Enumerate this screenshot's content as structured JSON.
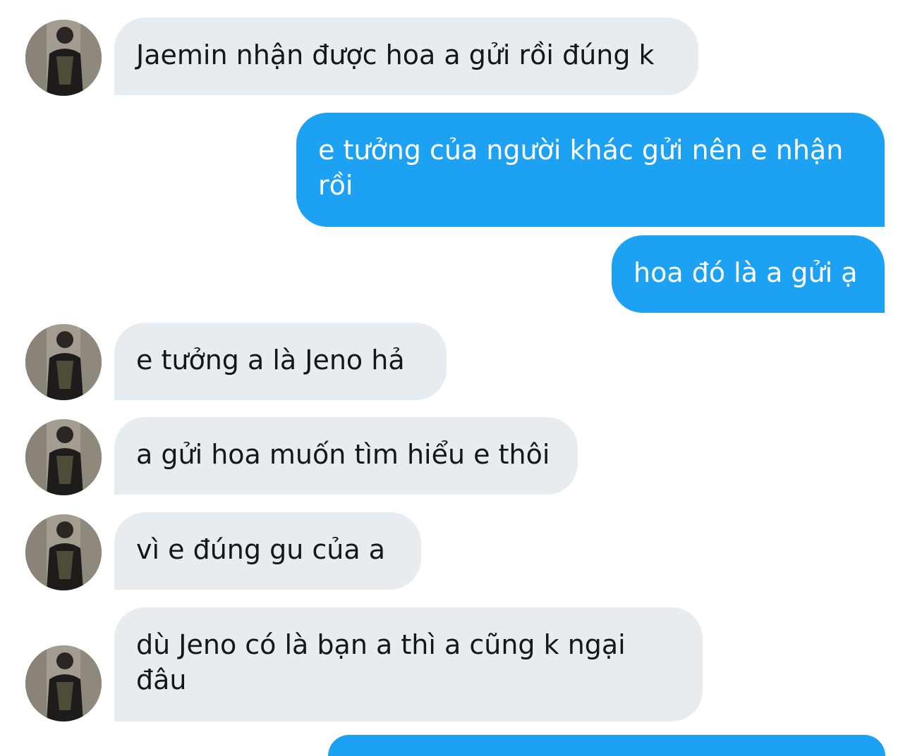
{
  "conversation": {
    "messages": [
      {
        "direction": "incoming",
        "text": "Jaemin nhận được hoa a gửi rồi đúng k"
      },
      {
        "direction": "outgoing",
        "text": "e tưởng của người khác gửi nên e nhận rồi"
      },
      {
        "direction": "outgoing",
        "text": "hoa đó là a gửi ạ"
      },
      {
        "direction": "incoming",
        "text": "e tưởng a là Jeno hả"
      },
      {
        "direction": "incoming",
        "text": "a gửi hoa muốn tìm hiểu e thôi"
      },
      {
        "direction": "incoming",
        "text": "vì e đúng gu của a"
      },
      {
        "direction": "incoming",
        "text": "dù Jeno có là bạn a thì a cũng k ngại đâu"
      }
    ]
  },
  "colors": {
    "incoming_bubble": "#e6ecf0",
    "outgoing_bubble": "#1da1f2",
    "incoming_text": "#14171a",
    "outgoing_text": "#ffffff"
  },
  "icons": {
    "avatar": "contact-avatar-photo"
  }
}
